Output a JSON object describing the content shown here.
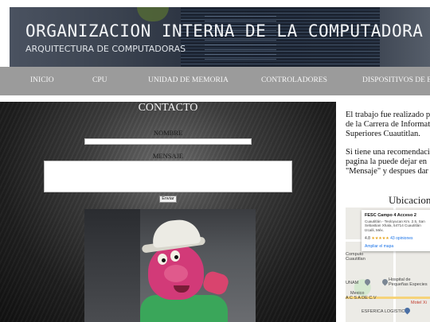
{
  "header": {
    "title": "ORGANIZACION INTERNA DE LA COMPUTADORA",
    "subtitle": "ARQUITECTURA DE COMPUTADORAS"
  },
  "nav": {
    "items": [
      {
        "label": "INICIO"
      },
      {
        "label": "CPU"
      },
      {
        "label": "UNIDAD DE MEMORIA"
      },
      {
        "label": "CONTROLADORES"
      },
      {
        "label": "DISPOSITIVOS DE E/S"
      }
    ]
  },
  "contact": {
    "title": "CONTACTO",
    "name_label": "NOMBRE",
    "message_label": "MENSAJE",
    "send_label": "Enviar"
  },
  "side": {
    "lines_a": [
      "El trabajo fue realizado p",
      "de la Carrera de Informat",
      "Superiores Cuautitlan."
    ],
    "lines_b": [
      "Si tiene una recomendaci",
      "pagina la puede dejar en",
      "\"Mensaje\" y despues dar"
    ],
    "location_title": "Ubicacion"
  },
  "map": {
    "card_title": "FESC Campo 4 Acceso 2",
    "card_address": "Cuautitlán - Teoloyucan Km. 2.5, San Sebastian Xhala, 54714 Cuautitlán Izcalli, Méx.",
    "rating": "4.8",
    "stars": "★★★★★",
    "reviews": "43 opiniones",
    "link": "Ampliar el mapa",
    "labels": [
      "Computo",
      "Cuautitlan",
      "Hospital de",
      "Pequeñas Especies",
      "UNAM",
      "Mexico",
      "A C S A DE C.V",
      "Motel Xi",
      "ESFERICA LOGISTIC"
    ]
  }
}
